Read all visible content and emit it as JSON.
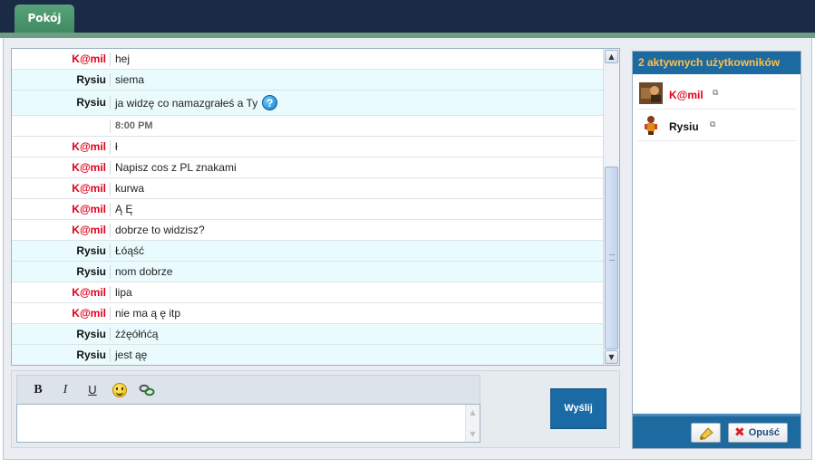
{
  "tabs": [
    {
      "label": "Pokój"
    }
  ],
  "messages": [
    {
      "nick": "K@mil",
      "text": "hej"
    },
    {
      "nick": "Rysiu",
      "text": "siema"
    },
    {
      "nick": "Rysiu",
      "text": "ja widzę co namazgrałeś a Ty"
    },
    {
      "time": "8:00 PM"
    },
    {
      "nick": "K@mil",
      "text": "ł"
    },
    {
      "nick": "K@mil",
      "text": "Napisz cos z PL znakami"
    },
    {
      "nick": "K@mil",
      "text": "kurwa"
    },
    {
      "nick": "K@mil",
      "text": "Ą Ę"
    },
    {
      "nick": "K@mil",
      "text": "dobrze to widzisz?"
    },
    {
      "nick": "Rysiu",
      "text": "Łóąść"
    },
    {
      "nick": "Rysiu",
      "text": "nom dobrze"
    },
    {
      "nick": "K@mil",
      "text": "lipa"
    },
    {
      "nick": "K@mil",
      "text": "nie ma ą ę itp"
    },
    {
      "nick": "Rysiu",
      "text": "żźęółńćą"
    },
    {
      "nick": "Rysiu",
      "text": "jest ąę"
    }
  ],
  "emoticon": {
    "glyph": "?",
    "icon": "question-emoticon-icon"
  },
  "toolbar": {
    "bold": "B",
    "italic": "I",
    "underline": "U"
  },
  "composer": {
    "send_label": "Wyślij"
  },
  "users_panel": {
    "title": "2 aktywnych użytkowników",
    "users": [
      {
        "name": "K@mil",
        "color": "#e0001a"
      },
      {
        "name": "Rysiu",
        "color": "#111111"
      }
    ],
    "leave_label": "Opuść"
  },
  "colors": {
    "header_bg": "#1b2a45",
    "tab_green": "#4a9a6e",
    "panel_blue": "#1d6aa0",
    "panel_title": "#ffc04a",
    "nick_red": "#e0001a",
    "alt_row": "#eafbfd"
  }
}
